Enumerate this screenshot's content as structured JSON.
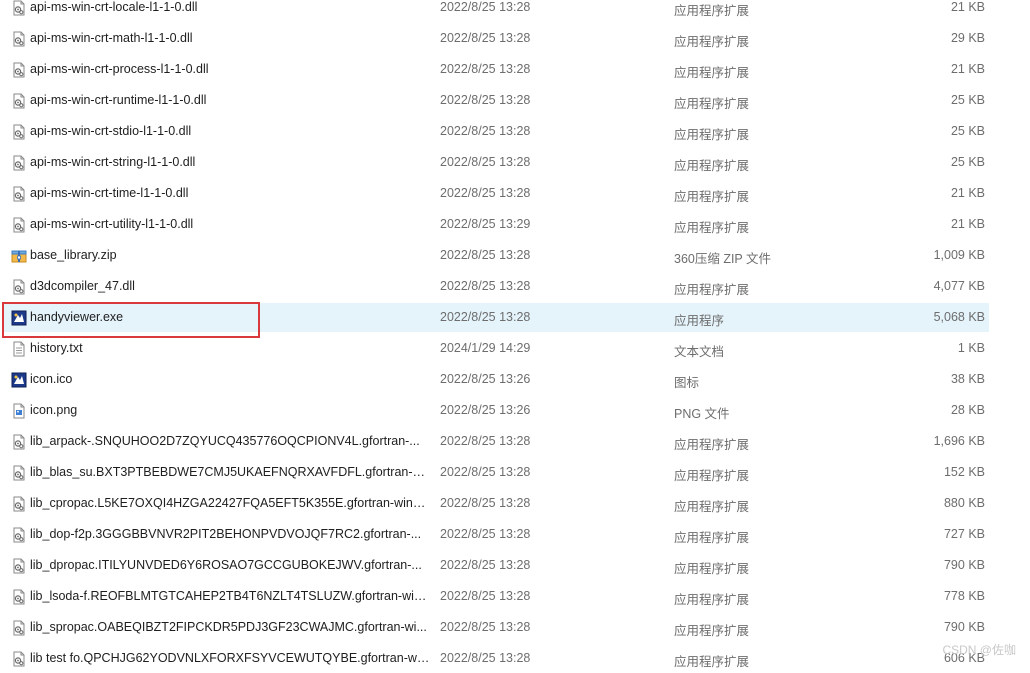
{
  "files": [
    {
      "name": "api-ms-win-crt-locale-l1-1-0.dll",
      "date": "2022/8/25 13:28",
      "type": "应用程序扩展",
      "size": "21 KB",
      "icon": "dll-icon"
    },
    {
      "name": "api-ms-win-crt-math-l1-1-0.dll",
      "date": "2022/8/25 13:28",
      "type": "应用程序扩展",
      "size": "29 KB",
      "icon": "dll-icon"
    },
    {
      "name": "api-ms-win-crt-process-l1-1-0.dll",
      "date": "2022/8/25 13:28",
      "type": "应用程序扩展",
      "size": "21 KB",
      "icon": "dll-icon"
    },
    {
      "name": "api-ms-win-crt-runtime-l1-1-0.dll",
      "date": "2022/8/25 13:28",
      "type": "应用程序扩展",
      "size": "25 KB",
      "icon": "dll-icon"
    },
    {
      "name": "api-ms-win-crt-stdio-l1-1-0.dll",
      "date": "2022/8/25 13:28",
      "type": "应用程序扩展",
      "size": "25 KB",
      "icon": "dll-icon"
    },
    {
      "name": "api-ms-win-crt-string-l1-1-0.dll",
      "date": "2022/8/25 13:28",
      "type": "应用程序扩展",
      "size": "25 KB",
      "icon": "dll-icon"
    },
    {
      "name": "api-ms-win-crt-time-l1-1-0.dll",
      "date": "2022/8/25 13:28",
      "type": "应用程序扩展",
      "size": "21 KB",
      "icon": "dll-icon"
    },
    {
      "name": "api-ms-win-crt-utility-l1-1-0.dll",
      "date": "2022/8/25 13:29",
      "type": "应用程序扩展",
      "size": "21 KB",
      "icon": "dll-icon"
    },
    {
      "name": "base_library.zip",
      "date": "2022/8/25 13:28",
      "type": "360压缩 ZIP 文件",
      "size": "1,009 KB",
      "icon": "zip-archive-icon"
    },
    {
      "name": "d3dcompiler_47.dll",
      "date": "2022/8/25 13:28",
      "type": "应用程序扩展",
      "size": "4,077 KB",
      "icon": "dll-icon"
    },
    {
      "name": "handyviewer.exe",
      "date": "2022/8/25 13:28",
      "type": "应用程序",
      "size": "5,068 KB",
      "icon": "app-exe-icon",
      "selected": true
    },
    {
      "name": "history.txt",
      "date": "2024/1/29 14:29",
      "type": "文本文档",
      "size": "1 KB",
      "icon": "text-file-icon"
    },
    {
      "name": "icon.ico",
      "date": "2022/8/25 13:26",
      "type": "图标",
      "size": "38 KB",
      "icon": "app-exe-icon"
    },
    {
      "name": "icon.png",
      "date": "2022/8/25 13:26",
      "type": "PNG 文件",
      "size": "28 KB",
      "icon": "image-file-icon"
    },
    {
      "name": "lib_arpack-.SNQUHOO2D7ZQYUCQ435776OQCPIONV4L.gfortran-...",
      "date": "2022/8/25 13:28",
      "type": "应用程序扩展",
      "size": "1,696 KB",
      "icon": "dll-icon"
    },
    {
      "name": "lib_blas_su.BXT3PTBEBDWE7CMJ5UKAEFNQRXAVFDFL.gfortran-wi...",
      "date": "2022/8/25 13:28",
      "type": "应用程序扩展",
      "size": "152 KB",
      "icon": "dll-icon"
    },
    {
      "name": "lib_cpropac.L5KE7OXQI4HZGA22427FQA5EFT5K355E.gfortran-win_...",
      "date": "2022/8/25 13:28",
      "type": "应用程序扩展",
      "size": "880 KB",
      "icon": "dll-icon"
    },
    {
      "name": "lib_dop-f2p.3GGGBBVNVR2PIT2BEHONPVDVOJQF7RC2.gfortran-...",
      "date": "2022/8/25 13:28",
      "type": "应用程序扩展",
      "size": "727 KB",
      "icon": "dll-icon"
    },
    {
      "name": "lib_dpropac.ITILYUNVDED6Y6ROSAO7GCCGUBOKEJWV.gfortran-...",
      "date": "2022/8/25 13:28",
      "type": "应用程序扩展",
      "size": "790 KB",
      "icon": "dll-icon"
    },
    {
      "name": "lib_lsoda-f.REOFBLMTGTCAHEP2TB4T6NZLT4TSLUZW.gfortran-win...",
      "date": "2022/8/25 13:28",
      "type": "应用程序扩展",
      "size": "778 KB",
      "icon": "dll-icon"
    },
    {
      "name": "lib_spropac.OABEQIBZT2FIPCKDR5PDJ3GF23CWAJMC.gfortran-wi...",
      "date": "2022/8/25 13:28",
      "type": "应用程序扩展",
      "size": "790 KB",
      "icon": "dll-icon"
    },
    {
      "name": "lib test fo.QPCHJG62YODVNLXFORXFSYVCEWUTQYBE.gfortran-wi...",
      "date": "2022/8/25 13:28",
      "type": "应用程序扩展",
      "size": "606 KB",
      "icon": "dll-icon"
    }
  ],
  "watermark": "CSDN @佐咖",
  "colors": {
    "selection_bg": "#e5f3fb",
    "highlight_border": "#d9383c",
    "secondary_text": "#6d6d6d"
  }
}
